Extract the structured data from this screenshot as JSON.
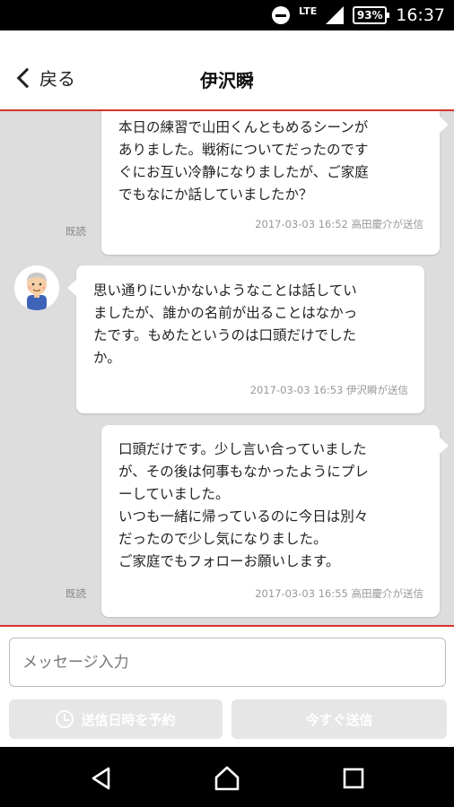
{
  "status_bar": {
    "network": "LTE",
    "battery": "93%",
    "time": "16:37"
  },
  "header": {
    "back_label": "戻る",
    "title": "伊沢瞬"
  },
  "messages": [
    {
      "side": "me",
      "text": "本日の練習で山田くんともめるシーンが\nありました。戦術についてだったのです\nぐにお互い冷静になりましたが、ご家庭\nでもなにか話していましたか？",
      "read": "既読",
      "meta": "2017-03-03 16:52 高田慶介が送信"
    },
    {
      "side": "them",
      "text": "思い通りにいかないようなことは話してい\nましたが、誰かの名前が出ることはなかっ\nたです。もめたというのは口頭だけでした\nか。",
      "meta": "2017-03-03 16:53 伊沢瞬が送信"
    },
    {
      "side": "me",
      "text": "口頭だけです。少し言い合っていました\nが、その後は何事もなかったようにプレ\nーしていました。\nいつも一緒に帰っているのに今日は別々\nだったので少し気になりました。\nご家庭でもフォローお願いします。",
      "read": "既読",
      "meta": "2017-03-03 16:55 高田慶介が送信"
    }
  ],
  "composer": {
    "placeholder": "メッセージ入力",
    "schedule_label": "送信日時を予約",
    "send_label": "今すぐ送信"
  }
}
